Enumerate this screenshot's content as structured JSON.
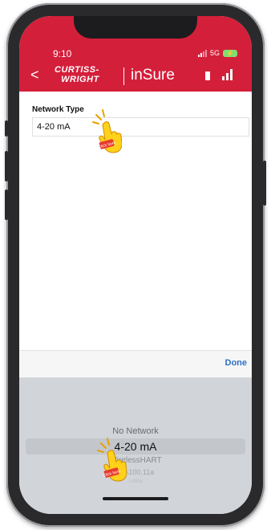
{
  "status_bar": {
    "time": "9:10",
    "network": "5G",
    "battery_icon": "charging-battery-icon"
  },
  "nav": {
    "back_glyph": "<",
    "logo_line1": "CURTISS-",
    "logo_line2": "WRIGHT",
    "app_title": "inSure",
    "brand_color": "#d41f3b"
  },
  "form": {
    "network_type_label": "Network Type",
    "network_type_value": "4-20 mA"
  },
  "picker": {
    "done_label": "Done",
    "options": [
      "No Network",
      "4-20 mA",
      "WirelessHART",
      "ISA100.11a",
      "LoRa"
    ],
    "selected": "4-20 mA"
  },
  "annotations": {
    "hand_label": "Click here"
  }
}
